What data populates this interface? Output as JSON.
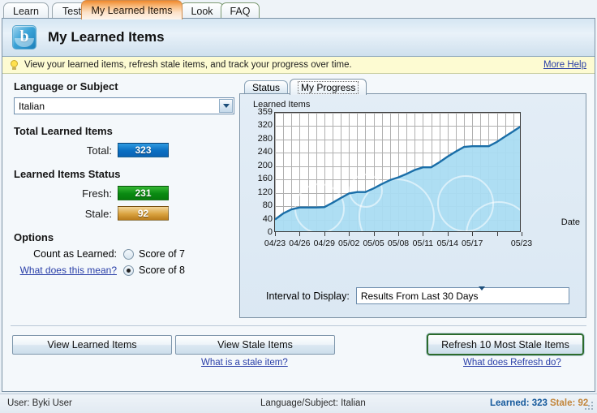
{
  "tabs": [
    {
      "label": "Learn",
      "active": false
    },
    {
      "label": "Test",
      "active": false
    },
    {
      "label": "My Learned Items",
      "active": true
    },
    {
      "label": "Look",
      "active": false
    },
    {
      "label": "FAQ",
      "active": false
    }
  ],
  "header": {
    "title": "My Learned Items",
    "logo_letter": "b"
  },
  "helpbar": {
    "message": "View your learned items, refresh stale items, and track your progress over time.",
    "more_help": "More Help"
  },
  "left": {
    "language_heading": "Language or Subject",
    "language_value": "Italian",
    "total_heading": "Total Learned Items",
    "total_label": "Total:",
    "total_value": "323",
    "status_heading": "Learned Items Status",
    "fresh_label": "Fresh:",
    "fresh_value": "231",
    "stale_label": "Stale:",
    "stale_value": "92",
    "options_heading": "Options",
    "count_as_learned_label": "Count as Learned:",
    "what_does_this_mean": "What does this mean?",
    "score7_label": "Score of 7",
    "score8_label": "Score of 8",
    "selected_score": "Score of 8"
  },
  "right": {
    "subtabs": [
      {
        "label": "Status",
        "active": false
      },
      {
        "label": "My Progress",
        "active": true
      }
    ],
    "interval_label": "Interval to Display:",
    "interval_value": "Results From Last 30 Days"
  },
  "buttons": {
    "view_learned": "View Learned Items",
    "view_stale": "View Stale Items",
    "refresh": "Refresh 10 Most Stale Items",
    "what_is_stale": "What is a stale item?",
    "what_does_refresh": "What does Refresh do?"
  },
  "statusbar": {
    "user": "User: Byki User",
    "language": "Language/Subject: Italian",
    "learned": "Learned: 323",
    "stale": "Stale: 92"
  },
  "colors": {
    "accent_orange": "#f08b2e",
    "total_blue": "#0a6fc2",
    "fresh_green": "#0a8a12",
    "stale_gold": "#d9a23f",
    "chart_line": "#1a6ea8",
    "chart_fill": "#aadcf2",
    "link": "#2a3fa8"
  },
  "chart_data": {
    "type": "area",
    "title": "",
    "ylabel": "Learned Items",
    "xlabel": "Date",
    "ylim": [
      0,
      359
    ],
    "yticks": [
      0,
      40,
      80,
      120,
      160,
      200,
      240,
      280,
      320,
      359
    ],
    "grid": true,
    "legend": "none",
    "xtick_labels": [
      "04/23",
      "04/26",
      "04/29",
      "05/02",
      "05/05",
      "05/08",
      "05/11",
      "05/14",
      "05/17",
      "05/23"
    ],
    "x": [
      "04/23",
      "04/24",
      "04/25",
      "04/26",
      "04/27",
      "04/28",
      "04/29",
      "04/30",
      "05/01",
      "05/02",
      "05/03",
      "05/04",
      "05/05",
      "05/06",
      "05/07",
      "05/08",
      "05/09",
      "05/10",
      "05/11",
      "05/12",
      "05/13",
      "05/14",
      "05/15",
      "05/16",
      "05/17",
      "05/18",
      "05/19",
      "05/20",
      "05/21",
      "05/22",
      "05/23"
    ],
    "values": [
      40,
      58,
      70,
      76,
      76,
      76,
      77,
      90,
      104,
      118,
      122,
      122,
      133,
      146,
      158,
      166,
      176,
      188,
      196,
      196,
      211,
      228,
      243,
      257,
      259,
      259,
      259,
      272,
      288,
      304,
      320
    ]
  }
}
